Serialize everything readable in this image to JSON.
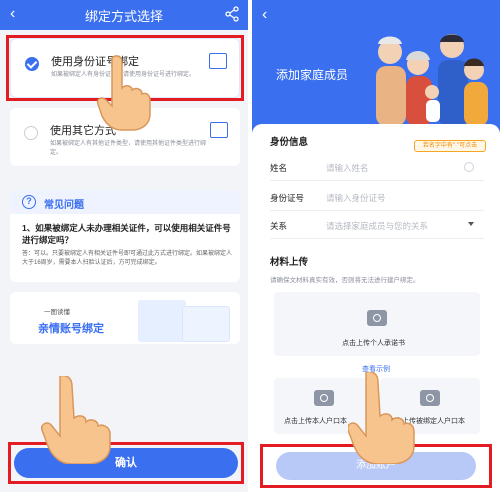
{
  "left": {
    "header_title": "绑定方式选择",
    "option1": {
      "title": "使用身份证号绑定",
      "desc": "如果被绑定人有身份证号，请使用身份证号进行绑定。"
    },
    "option2": {
      "title": "使用其它方式",
      "desc": "如果被绑定人有其他证件类型，请使用其他证件类型进行绑定。"
    },
    "faq": {
      "title": "常见问题",
      "question": "1、如果被绑定人未办理相关证件，可以使用相关证件号进行绑定吗？",
      "answer": "答：可以。只要被绑定人有相关证件号即可通过此方式进行绑定。如果被绑定人大于16周岁，需要本人扫脸认证后，方可完成绑定。"
    },
    "banner": {
      "small": "一图读懂",
      "big": "亲情账号绑定"
    },
    "confirm_button": "确认"
  },
  "right": {
    "header_title": "添加家庭成员",
    "section_identity": "身份信息",
    "tag": "若名字中有\"·\"可点击",
    "fields": {
      "name": {
        "label": "姓名",
        "placeholder": "请输入姓名"
      },
      "id": {
        "label": "身份证号",
        "placeholder": "请输入身份证号"
      },
      "relation": {
        "label": "关系",
        "placeholder": "请选择家庭成员与您的关系"
      }
    },
    "section_material": "材料上传",
    "material_hint": "请确保文材料真实有效，否则将无法进行建户绑定。",
    "upload_commitment": "点击上传个人承诺书",
    "view_example": "查看示例",
    "upload_own_hukou": "点击上传本人户口本",
    "upload_bound_hukou": "点击上传被绑定人户口本",
    "add_button": "添加账户"
  },
  "colors": {
    "primary": "#3a6ff0",
    "highlight_red": "#e31b23",
    "disabled_button": "#b9c9f7"
  }
}
